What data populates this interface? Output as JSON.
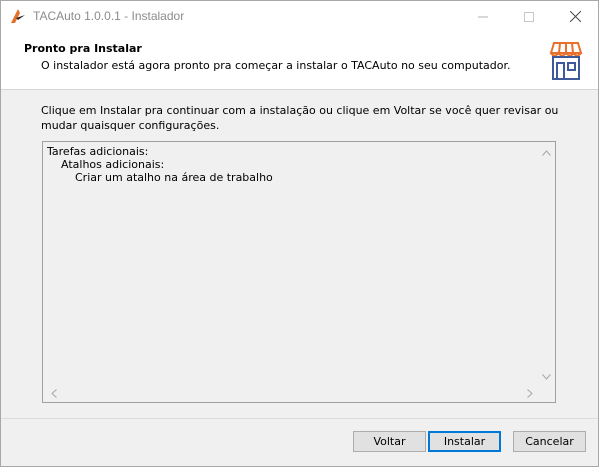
{
  "window": {
    "title": "TACAuto 1.0.0.1 - Instalador"
  },
  "header": {
    "title": "Pronto pra Instalar",
    "subtitle": "O instalador está agora pronto pra começar a instalar o TACAuto no seu computador."
  },
  "body": {
    "instruction": "Clique em Instalar pra continuar com a instalação ou clique em Voltar se você quer revisar ou mudar quaisquer configurações."
  },
  "memo": {
    "lines": [
      "Tarefas adicionais:",
      "Atalhos adicionais:",
      "Criar um atalho na área de trabalho"
    ]
  },
  "buttons": {
    "back": "Voltar",
    "install": "Instalar",
    "cancel": "Cancelar"
  },
  "colors": {
    "accent": "#0078d7",
    "icon_orange": "#e8702a",
    "icon_blue": "#3e5a9a"
  }
}
